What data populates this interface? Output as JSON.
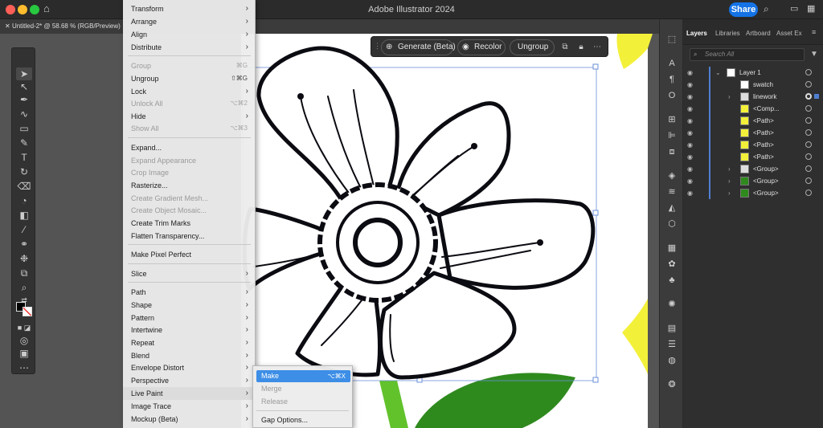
{
  "window": {
    "title": "Adobe Illustrator 2024",
    "share_label": "Share"
  },
  "document_tab": {
    "label": "Untitled-2* @ 58.68 % (RGB/Preview)"
  },
  "context_bar": {
    "generate": "Generate (Beta)",
    "recolor": "Recolor",
    "ungroup": "Ungroup"
  },
  "object_menu": {
    "items": [
      {
        "label": "Transform",
        "shortcut": "",
        "submenu": true,
        "disabled": false
      },
      {
        "label": "Arrange",
        "shortcut": "",
        "submenu": true,
        "disabled": false
      },
      {
        "label": "Align",
        "shortcut": "",
        "submenu": true,
        "disabled": false
      },
      {
        "label": "Distribute",
        "shortcut": "",
        "submenu": true,
        "disabled": false
      },
      {
        "label": "Group",
        "shortcut": "⌘G",
        "submenu": false,
        "disabled": true
      },
      {
        "label": "Ungroup",
        "shortcut": "⇧⌘G",
        "submenu": false,
        "disabled": false
      },
      {
        "label": "Lock",
        "shortcut": "",
        "submenu": true,
        "disabled": false
      },
      {
        "label": "Unlock All",
        "shortcut": "⌥⌘2",
        "submenu": false,
        "disabled": true
      },
      {
        "label": "Hide",
        "shortcut": "",
        "submenu": true,
        "disabled": false
      },
      {
        "label": "Show All",
        "shortcut": "⌥⌘3",
        "submenu": false,
        "disabled": true
      },
      {
        "label": "Expand...",
        "shortcut": "",
        "submenu": false,
        "disabled": false
      },
      {
        "label": "Expand Appearance",
        "shortcut": "",
        "submenu": false,
        "disabled": true
      },
      {
        "label": "Crop Image",
        "shortcut": "",
        "submenu": false,
        "disabled": true
      },
      {
        "label": "Rasterize...",
        "shortcut": "",
        "submenu": false,
        "disabled": false
      },
      {
        "label": "Create Gradient Mesh...",
        "shortcut": "",
        "submenu": false,
        "disabled": true
      },
      {
        "label": "Create Object Mosaic...",
        "shortcut": "",
        "submenu": false,
        "disabled": true
      },
      {
        "label": "Create Trim Marks",
        "shortcut": "",
        "submenu": false,
        "disabled": false
      },
      {
        "label": "Flatten Transparency...",
        "shortcut": "",
        "submenu": false,
        "disabled": false
      },
      {
        "label": "Make Pixel Perfect",
        "shortcut": "",
        "submenu": false,
        "disabled": false
      },
      {
        "label": "Slice",
        "shortcut": "",
        "submenu": true,
        "disabled": false
      },
      {
        "label": "Path",
        "shortcut": "",
        "submenu": true,
        "disabled": false
      },
      {
        "label": "Shape",
        "shortcut": "",
        "submenu": true,
        "disabled": false
      },
      {
        "label": "Pattern",
        "shortcut": "",
        "submenu": true,
        "disabled": false
      },
      {
        "label": "Intertwine",
        "shortcut": "",
        "submenu": true,
        "disabled": false
      },
      {
        "label": "Repeat",
        "shortcut": "",
        "submenu": true,
        "disabled": false
      },
      {
        "label": "Blend",
        "shortcut": "",
        "submenu": true,
        "disabled": false
      },
      {
        "label": "Envelope Distort",
        "shortcut": "",
        "submenu": true,
        "disabled": false
      },
      {
        "label": "Perspective",
        "shortcut": "",
        "submenu": true,
        "disabled": false
      },
      {
        "label": "Live Paint",
        "shortcut": "",
        "submenu": true,
        "disabled": false
      },
      {
        "label": "Image Trace",
        "shortcut": "",
        "submenu": true,
        "disabled": false
      },
      {
        "label": "Mockup (Beta)",
        "shortcut": "",
        "submenu": true,
        "disabled": false
      }
    ]
  },
  "live_paint_submenu": {
    "items": [
      {
        "label": "Make",
        "shortcut": "⌥⌘X",
        "disabled": false,
        "active": true
      },
      {
        "label": "Merge",
        "shortcut": "",
        "disabled": true,
        "active": false
      },
      {
        "label": "Release",
        "shortcut": "",
        "disabled": true,
        "active": false
      },
      {
        "label": "Gap Options...",
        "shortcut": "",
        "disabled": false,
        "active": false
      }
    ]
  },
  "layers_panel": {
    "tabs": [
      "Layers",
      "Libraries",
      "Artboard",
      "Asset Ex"
    ],
    "search_placeholder": "Search All",
    "rows": [
      {
        "name": "Layer 1",
        "thumb": "white",
        "twirl": true
      },
      {
        "name": "swatch",
        "thumb": "white",
        "twirl": false
      },
      {
        "name": "linework",
        "thumb": "art",
        "twirl": true
      },
      {
        "name": "<Comp...",
        "thumb": "yellow",
        "twirl": false
      },
      {
        "name": "<Path>",
        "thumb": "yellow",
        "twirl": false
      },
      {
        "name": "<Path>",
        "thumb": "yellow",
        "twirl": false
      },
      {
        "name": "<Path>",
        "thumb": "yellow",
        "twirl": false
      },
      {
        "name": "<Path>",
        "thumb": "yellow",
        "twirl": false
      },
      {
        "name": "<Group>",
        "thumb": "art",
        "twirl": true
      },
      {
        "name": "<Group>",
        "thumb": "green",
        "twirl": true
      },
      {
        "name": "<Group>",
        "thumb": "green",
        "twirl": true
      }
    ]
  },
  "colors": {
    "accent": "#1473e6",
    "menu_highlight": "#3d8ee6",
    "layer_bar": "#4f7fd1",
    "leaf_green": "#2f8a1e",
    "stem_green": "#62c22c",
    "yellow": "#f3f03a"
  }
}
